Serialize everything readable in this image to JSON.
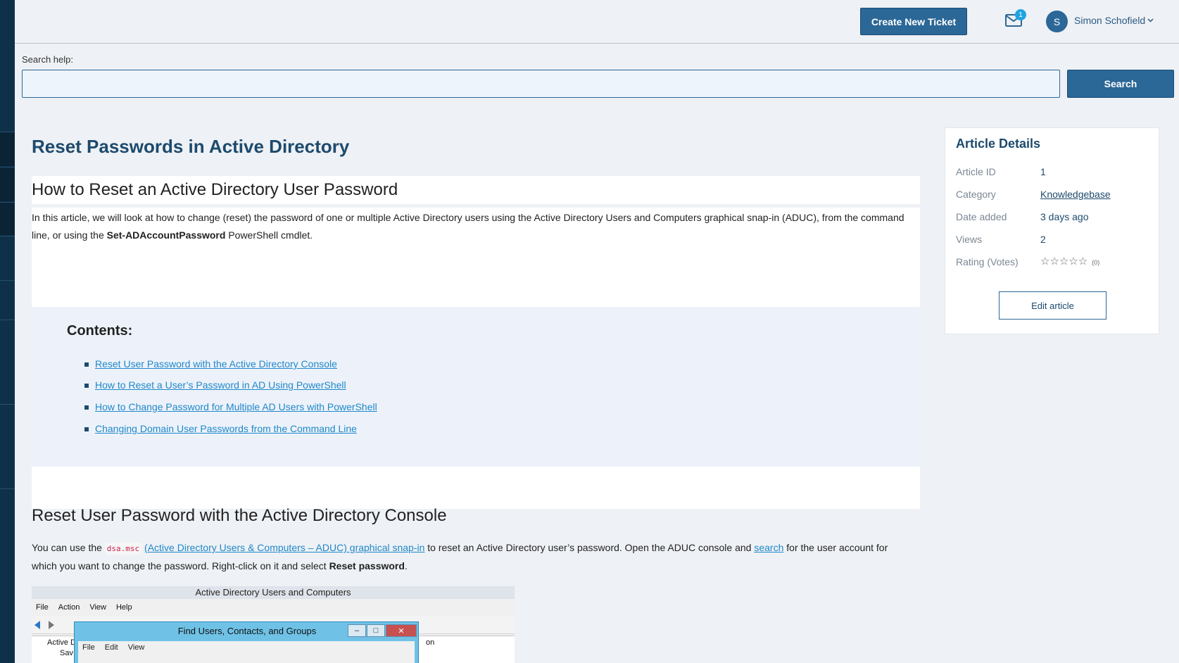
{
  "topbar": {
    "create_ticket": "Create New Ticket",
    "mail_badge": "1",
    "avatar_initial": "S",
    "user_name": "Simon Schofield"
  },
  "search": {
    "label": "Search help:",
    "placeholder": "",
    "button": "Search"
  },
  "article": {
    "title": "Reset Passwords in Active Directory",
    "h2_intro": "How to Reset an Active Directory User Password",
    "intro_part1": "In this article, we will look at how to change (reset) the password of one or multiple Active Directory users using the Active Directory Users and Computers graphical snap-in (ADUC), from the command line, or using the ",
    "intro_bold": "Set-ADAccountPassword",
    "intro_part2": " PowerShell cmdlet.",
    "contents_title": "Contents:",
    "toc": [
      "Reset User Password with the Active Directory Console",
      "How to Reset a User’s Password in AD Using PowerShell",
      "How to Change Password for Multiple AD Users with PowerShell",
      "Changing Domain User Passwords from the Command Line"
    ],
    "h2_console": "Reset User Password with the Active Directory Console",
    "console_p1": "You can use the ",
    "console_code": "dsa.msc",
    "console_link1": "(Active Directory Users & Computers – ADUC) graphical snap-in",
    "console_p2": " to reset an Active Directory user’s password. Open the ADUC console and ",
    "console_link2": "search",
    "console_p3": " for the user account for which you want to change the password. Right-click on it and select ",
    "console_bold": "Reset password",
    "console_p4": "."
  },
  "screenshot": {
    "window_title": "Active Directory Users and Computers",
    "menu": [
      "File",
      "Action",
      "View",
      "Help"
    ],
    "tree_item1": "Active D",
    "tree_item2": "Sav",
    "tree_col": "on",
    "dialog_title": "Find Users, Contacts, and Groups",
    "dialog_menu": [
      "File",
      "Edit",
      "View"
    ]
  },
  "details": {
    "title": "Article Details",
    "rows": [
      {
        "key": "Article ID",
        "value": "1"
      },
      {
        "key": "Category",
        "value": "Knowledgebase"
      },
      {
        "key": "Date added",
        "value": "3 days ago"
      },
      {
        "key": "Views",
        "value": "2"
      },
      {
        "key": "Rating (Votes)",
        "value": ""
      }
    ],
    "votes": "(0)",
    "rating": 0,
    "edit_button": "Edit article"
  },
  "colors": {
    "primary": "#2b6797",
    "link": "#1f88c9",
    "heading": "#1d4a6d",
    "sidebar": "#0f3049"
  }
}
